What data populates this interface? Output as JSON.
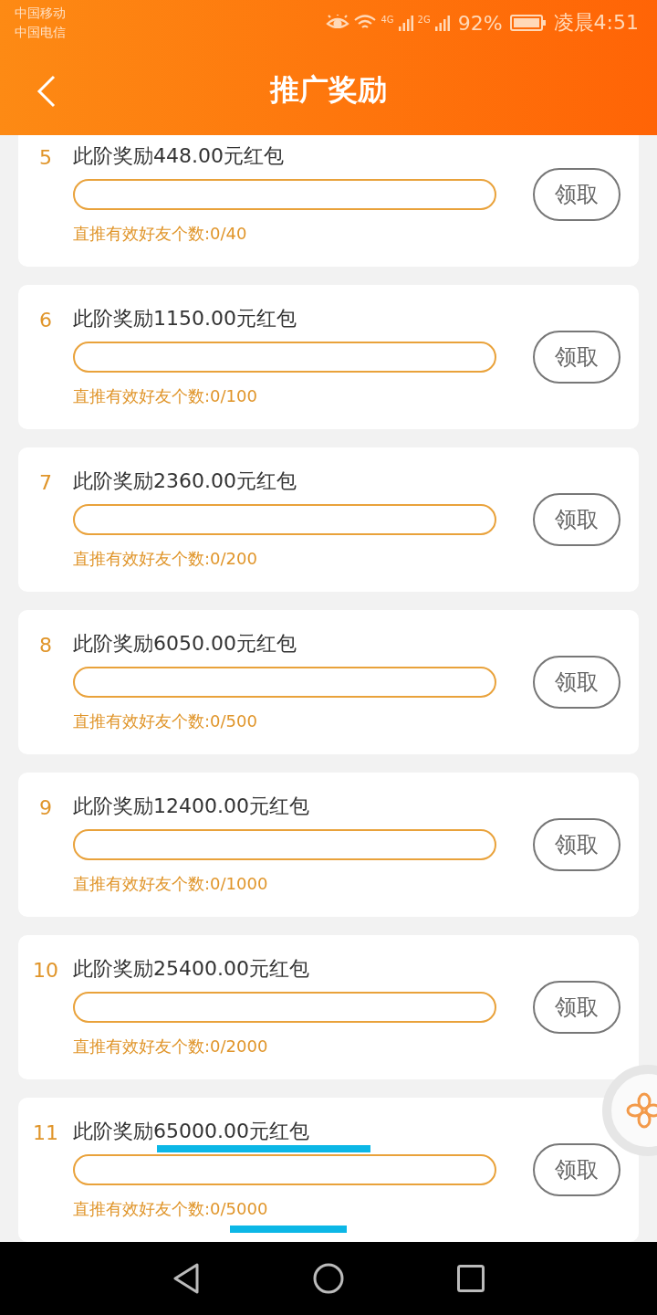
{
  "status_bar": {
    "carriers": [
      "中国移动",
      "中国电信"
    ],
    "network_1": "4G",
    "network_2": "2G",
    "battery": "92%",
    "time": "凌晨4:51"
  },
  "header": {
    "title": "推广奖励"
  },
  "tiers": [
    {
      "index": "5",
      "title": "此阶奖励448.00元红包",
      "level": 0,
      "progress": "直推有效好友个数:0/40",
      "button": "领取",
      "highlighted": false
    },
    {
      "index": "6",
      "title": "此阶奖励1150.00元红包",
      "level": 0,
      "progress": "直推有效好友个数:0/100",
      "button": "领取",
      "highlighted": false
    },
    {
      "index": "7",
      "title": "此阶奖励2360.00元红包",
      "level": 0,
      "progress": "直推有效好友个数:0/200",
      "button": "领取",
      "highlighted": false
    },
    {
      "index": "8",
      "title": "此阶奖励6050.00元红包",
      "level": 0,
      "progress": "直推有效好友个数:0/500",
      "button": "领取",
      "highlighted": false
    },
    {
      "index": "9",
      "title": "此阶奖励12400.00元红包",
      "level": 0,
      "progress": "直推有效好友个数:0/1000",
      "button": "领取",
      "highlighted": false
    },
    {
      "index": "10",
      "title": "此阶奖励25400.00元红包",
      "level": 0,
      "progress": "直推有效好友个数:0/2000",
      "button": "领取",
      "highlighted": false
    },
    {
      "index": "11",
      "title": "此阶奖励65000.00元红包",
      "level": 0,
      "progress": "直推有效好友个数:0/5000",
      "button": "领取",
      "highlighted": true
    }
  ]
}
